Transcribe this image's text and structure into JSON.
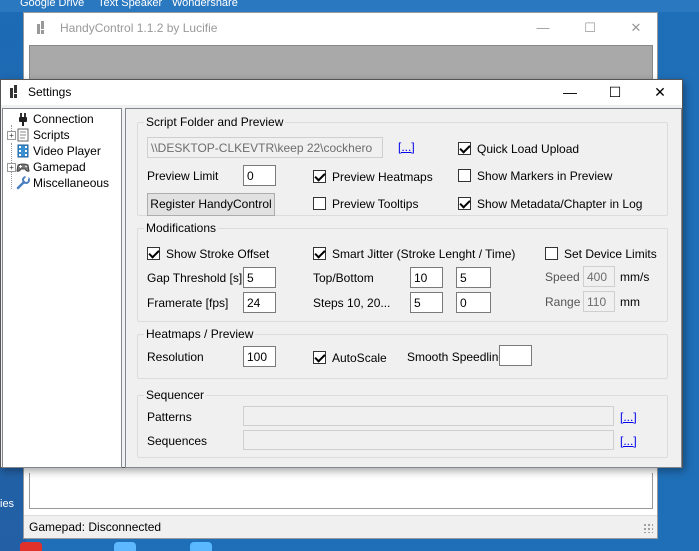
{
  "desktop": {
    "taskbar_items": [
      "Google Drive",
      "Text Speaker",
      "Wondershare"
    ],
    "left_label": "ies",
    "colors": {
      "background": "#1f6fb8"
    }
  },
  "main_window": {
    "title": "HandyControl 1.1.2 by Lucifie",
    "icon": "handycontrol-logo-icon",
    "controls": {
      "minimize": "—",
      "maximize": "☐",
      "close": "✕"
    },
    "status": "Gamepad: Disconnected"
  },
  "settings": {
    "title": "Settings",
    "controls": {
      "minimize": "—",
      "maximize": "☐",
      "close": "✕"
    },
    "tree": [
      {
        "label": "Connection",
        "icon": "plug-icon"
      },
      {
        "label": "Scripts",
        "icon": "script-page-icon"
      },
      {
        "label": "Video Player",
        "icon": "film-strip-icon"
      },
      {
        "label": "Gamepad",
        "icon": "gamepad-icon"
      },
      {
        "label": "Miscellaneous",
        "icon": "wrench-icon"
      }
    ],
    "script_folder": {
      "title": "Script Folder and Preview",
      "path": "\\\\DESKTOP-CLKEVTR\\keep 22\\cockhero",
      "browse": "[...]",
      "preview_limit_label": "Preview Limit",
      "preview_limit_value": "0",
      "register_button": "Register HandyControl",
      "preview_heatmaps": {
        "label": "Preview Heatmaps",
        "checked": true
      },
      "preview_tooltips": {
        "label": "Preview Tooltips",
        "checked": false
      },
      "quick_load_upload": {
        "label": "Quick Load Upload",
        "checked": true
      },
      "show_markers": {
        "label": "Show Markers in Preview",
        "checked": false
      },
      "show_metadata": {
        "label": "Show Metadata/Chapter in Log",
        "checked": true
      }
    },
    "modifications": {
      "title": "Modifications",
      "show_stroke_offset": {
        "label": "Show Stroke Offset",
        "checked": true
      },
      "smart_jitter": {
        "label": "Smart Jitter (Stroke Lenght / Time)",
        "checked": true
      },
      "gap_threshold_label": "Gap Threshold [s]",
      "gap_threshold_value": "5",
      "framerate_label": "Framerate [fps]",
      "framerate_value": "24",
      "top_bottom_label": "Top/Bottom",
      "top_bottom_values": [
        "10",
        "5"
      ],
      "steps_label": "Steps 10, 20...",
      "steps_values": [
        "5",
        "0"
      ],
      "set_device_limits": {
        "label": "Set Device Limits",
        "checked": false
      },
      "speed_label": "Speed",
      "speed_value": "400",
      "speed_unit": "mm/s",
      "range_label": "Range",
      "range_value": "110",
      "range_unit": "mm"
    },
    "heatmaps": {
      "title": "Heatmaps / Preview",
      "resolution_label": "Resolution",
      "resolution_value": "100",
      "autoscale": {
        "label": "AutoScale",
        "checked": true
      },
      "smooth_speedline_label": "Smooth Speedline",
      "smooth_speedline_value": ""
    },
    "sequencer": {
      "title": "Sequencer",
      "patterns_label": "Patterns",
      "patterns_browse": "[...]",
      "sequences_label": "Sequences",
      "sequences_browse": "[...]"
    }
  }
}
